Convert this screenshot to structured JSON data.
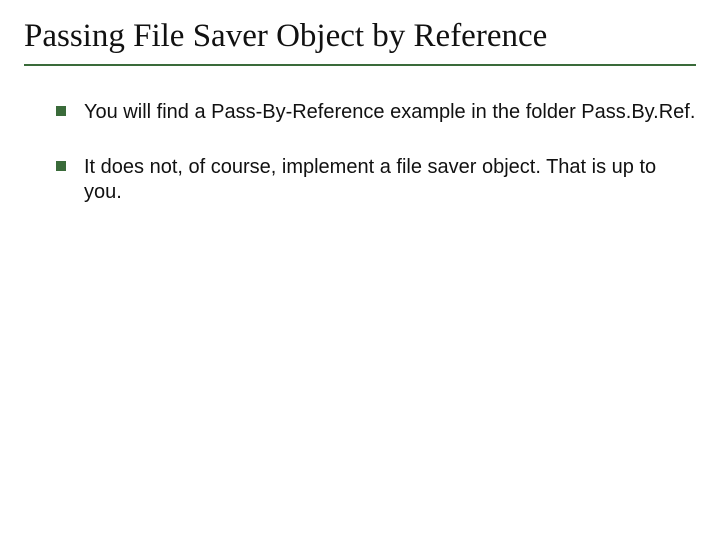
{
  "title": "Passing File Saver Object by Reference",
  "bullets": [
    "You will find a Pass-By-Reference example in the folder Pass.By.Ref.",
    "It does not, of course, implement a file saver object. That is up to you."
  ]
}
